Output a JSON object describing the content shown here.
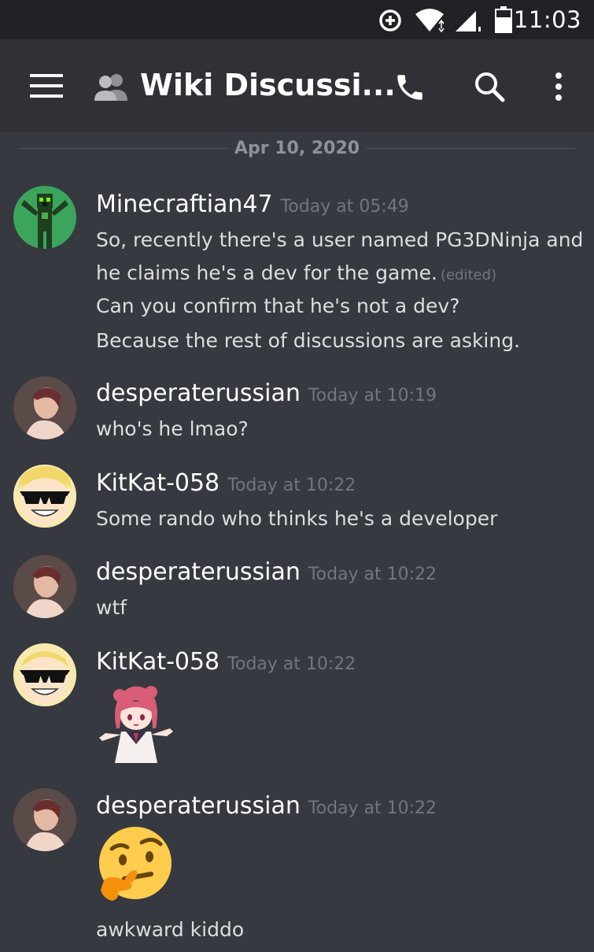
{
  "status_bar": {
    "time": "11:03",
    "icons": [
      "data-saver-icon",
      "wifi-icon",
      "cell-signal-icon",
      "battery-icon"
    ]
  },
  "header": {
    "title": "Wiki Discussi...",
    "icons": [
      "menu-icon",
      "group-icon",
      "phone-icon",
      "search-icon",
      "more-vert-icon"
    ]
  },
  "divider": {
    "date": "Apr 10, 2020"
  },
  "messages": [
    {
      "author": "Minecraftian47",
      "time": "Today at 05:49",
      "lines": [
        "So, recently there's a user named PG3DNinja and",
        "he claims he's a dev for the game.",
        "Can you confirm that he's not a dev?",
        "Because the rest of discussions are asking."
      ],
      "edited_label": "(edited)"
    },
    {
      "author": "desperaterussian",
      "time": "Today at 10:19",
      "lines": [
        "who's he lmao?"
      ]
    },
    {
      "author": "KitKat-058",
      "time": "Today at 10:22",
      "lines": [
        "Some rando who thinks he's a developer"
      ]
    },
    {
      "author": "desperaterussian",
      "time": "Today at 10:22",
      "lines": [
        "wtf"
      ]
    },
    {
      "author": "KitKat-058",
      "time": "Today at 10:22",
      "lines": [],
      "attachment": "anime-girl-sticker"
    },
    {
      "author": "desperaterussian",
      "time": "Today at 10:22",
      "lines": [
        "awkward kiddo"
      ],
      "attachment": "thinking-face-emoji"
    }
  ],
  "colors": {
    "background": "#36393f",
    "header": "#2f3136",
    "statusbar": "#202225",
    "text": "#dcddde",
    "muted": "#72767d",
    "avatar_green": "#3ba55c"
  }
}
